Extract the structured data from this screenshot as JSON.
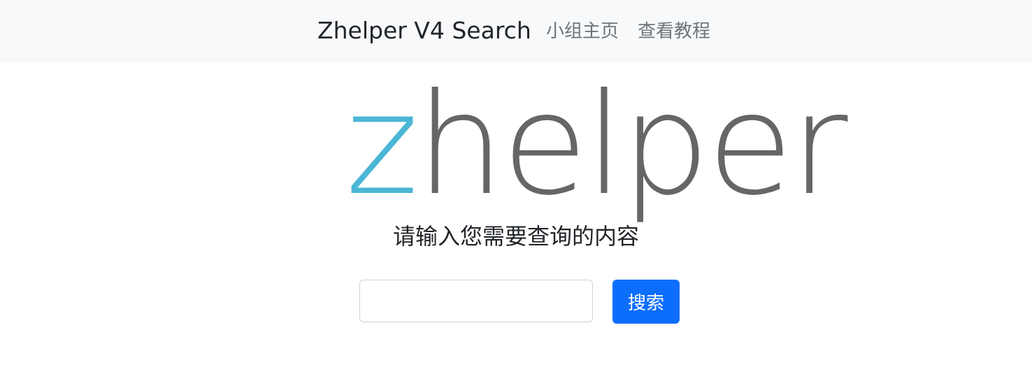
{
  "navbar": {
    "brand": "Zhelper V4 Search",
    "links": [
      {
        "label": "小组主页"
      },
      {
        "label": "查看教程"
      }
    ]
  },
  "logo": {
    "first_letter": "z",
    "rest": "helper",
    "colors": {
      "first_letter": "#4bb6d6",
      "rest": "#666666"
    }
  },
  "main": {
    "prompt": "请输入您需要查询的内容",
    "search": {
      "value": "",
      "placeholder": "",
      "button_label": "搜索"
    }
  },
  "colors": {
    "navbar_bg": "#f8f9fa",
    "primary": "#0d6efd",
    "nav_link": "#6c757d"
  }
}
